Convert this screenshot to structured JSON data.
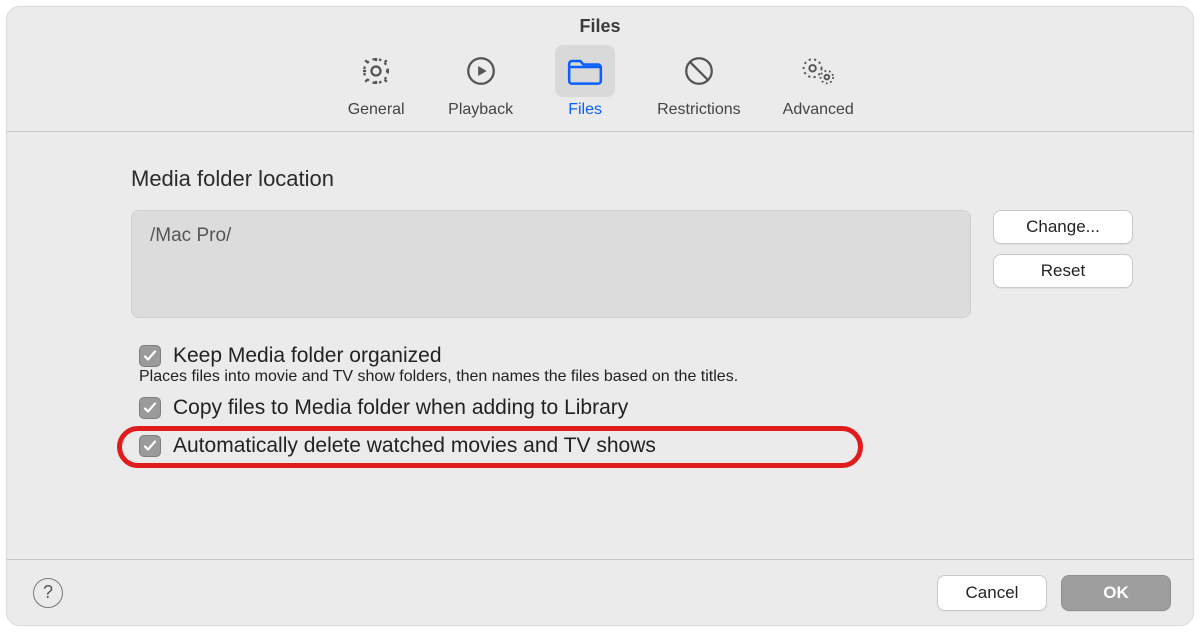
{
  "window": {
    "title": "Files"
  },
  "tabs": {
    "general": {
      "label": "General"
    },
    "playback": {
      "label": "Playback"
    },
    "files": {
      "label": "Files",
      "selected": true
    },
    "restrictions": {
      "label": "Restrictions"
    },
    "advanced": {
      "label": "Advanced"
    }
  },
  "media": {
    "section_label": "Media folder location",
    "path": "/Mac Pro/",
    "change_label": "Change...",
    "reset_label": "Reset"
  },
  "options": {
    "keep_organized": {
      "checked": true,
      "label": "Keep Media folder organized",
      "description": "Places files into movie and TV show folders, then names the files based on the titles."
    },
    "copy_to_library": {
      "checked": true,
      "label": "Copy files to Media folder when adding to Library"
    },
    "auto_delete": {
      "checked": true,
      "label": "Automatically delete watched movies and TV shows",
      "highlighted": true
    }
  },
  "footer": {
    "help_label": "?",
    "cancel_label": "Cancel",
    "ok_label": "OK"
  }
}
